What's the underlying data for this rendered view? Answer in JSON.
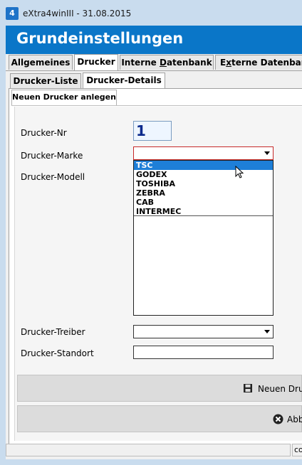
{
  "window": {
    "icon_text": "4",
    "title": "eXtra4winIII  -  31.08.2015"
  },
  "header": {
    "title": "Grundeinstellungen"
  },
  "main_tabs": [
    {
      "label": "Allgemeines",
      "active": false
    },
    {
      "label": "Drucker",
      "active": true
    },
    {
      "label_pre": "Interne ",
      "label_u": "D",
      "label_post": "atenbank",
      "active": false
    },
    {
      "label_pre": "E",
      "label_u": "x",
      "label_post": "terne Datenbank",
      "active": false
    }
  ],
  "sub_tabs": [
    {
      "label": "Drucker-Liste",
      "active": false
    },
    {
      "label": "Drucker-Details",
      "active": true
    }
  ],
  "action_tab": {
    "label": "Neuen Drucker anlegen"
  },
  "form": {
    "nr_label": "Drucker-Nr",
    "nr_value": "1",
    "marke_label": "Drucker-Marke",
    "marke_value": "",
    "modell_label": "Drucker-Modell",
    "treiber_label": "Drucker-Treiber",
    "treiber_value": "",
    "standort_label": "Drucker-Standort",
    "standort_value": ""
  },
  "dropdown": {
    "options": [
      "TSC",
      "GODEX",
      "TOSHIBA",
      "ZEBRA",
      "CAB",
      "INTERMEC"
    ],
    "selected_index": 0
  },
  "buttons": {
    "new_label": "Neuen Dru",
    "new_icon": "save-icon",
    "cancel_label": "Abb",
    "cancel_icon": "cancel-icon"
  },
  "statusbar": {
    "right_text": "co"
  },
  "colors": {
    "header_blue": "#0a76c8",
    "selection_blue": "#1e7fd8",
    "nr_text": "#0b2a8c",
    "marke_border_red": "#c62828"
  }
}
